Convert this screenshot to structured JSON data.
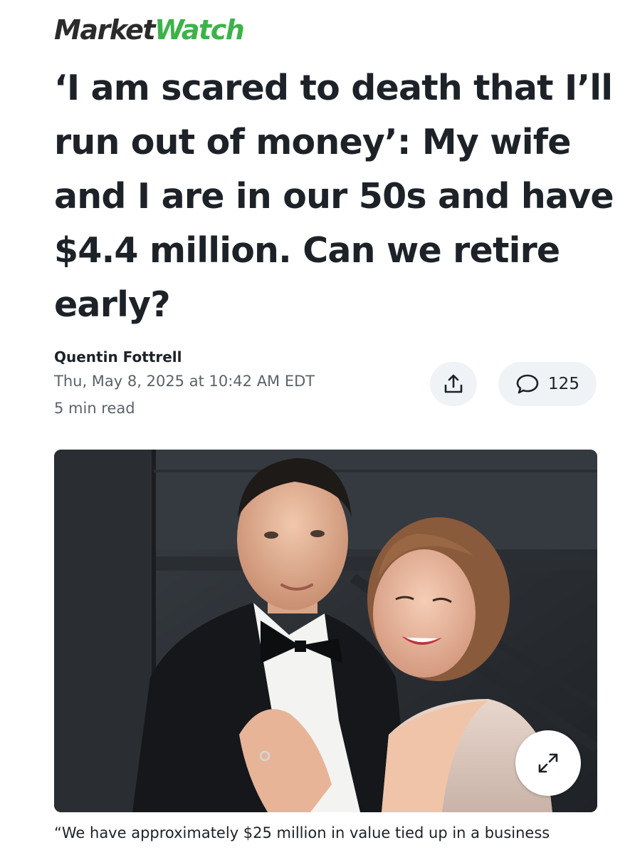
{
  "brand": {
    "logo_part1": "Market",
    "logo_part2": "Watch",
    "logo_color_dark": "#2b2b2b",
    "logo_color_green": "#3cb34a"
  },
  "article": {
    "headline": "‘I am scared to death that I’ll run out of money’: My wife and I are in our 50s and have $4.4 million. Can we retire early?",
    "author": "Quentin Fottrell",
    "date": "Thu, May 8, 2025 at 10:42 AM EDT",
    "read_time": "5 min read",
    "caption_line1": "“We have approximately $25 million in value tied up in a business"
  },
  "actions": {
    "share_icon": "share-icon",
    "comments_icon": "comment-bubble-icon",
    "comments_count": "125",
    "expand_icon": "expand-arrows-icon"
  },
  "photo": {
    "subject": "photo-of-couple"
  }
}
